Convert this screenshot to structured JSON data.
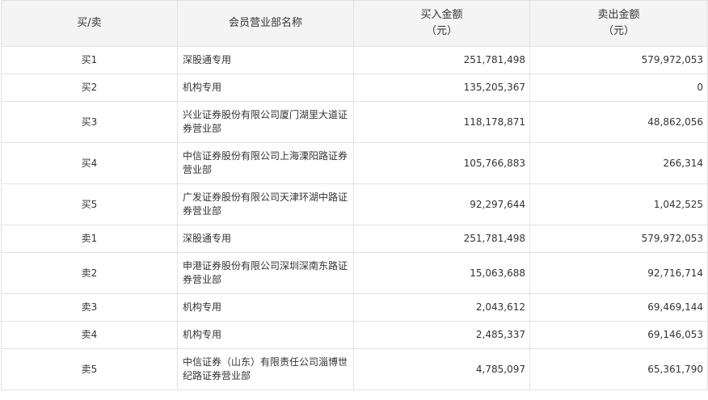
{
  "table": {
    "headers": {
      "type": "买/卖",
      "name": "会员营业部名称",
      "buy_line1": "买入金额",
      "buy_line2": "（元）",
      "sell_line1": "卖出金额",
      "sell_line2": "（元）"
    },
    "rows": [
      {
        "type": "买1",
        "name": "深股通专用",
        "buy": "251,781,498",
        "sell": "579,972,053"
      },
      {
        "type": "买2",
        "name": "机构专用",
        "buy": "135,205,367",
        "sell": "0"
      },
      {
        "type": "买3",
        "name": "兴业证券股份有限公司厦门湖里大道证券营业部",
        "buy": "118,178,871",
        "sell": "48,862,056"
      },
      {
        "type": "买4",
        "name": "中信证券股份有限公司上海溧阳路证券营业部",
        "buy": "105,766,883",
        "sell": "266,314"
      },
      {
        "type": "买5",
        "name": "广发证券股份有限公司天津环湖中路证券营业部",
        "buy": "92,297,644",
        "sell": "1,042,525"
      },
      {
        "type": "卖1",
        "name": "深股通专用",
        "buy": "251,781,498",
        "sell": "579,972,053"
      },
      {
        "type": "卖2",
        "name": "申港证券股份有限公司深圳深南东路证券营业部",
        "buy": "15,063,688",
        "sell": "92,716,714"
      },
      {
        "type": "卖3",
        "name": "机构专用",
        "buy": "2,043,612",
        "sell": "69,469,144"
      },
      {
        "type": "卖4",
        "name": "机构专用",
        "buy": "2,485,337",
        "sell": "69,146,053"
      },
      {
        "type": "卖5",
        "name": "中信证券（山东）有限责任公司淄博世纪路证券营业部",
        "buy": "4,785,097",
        "sell": "65,361,790"
      }
    ]
  }
}
